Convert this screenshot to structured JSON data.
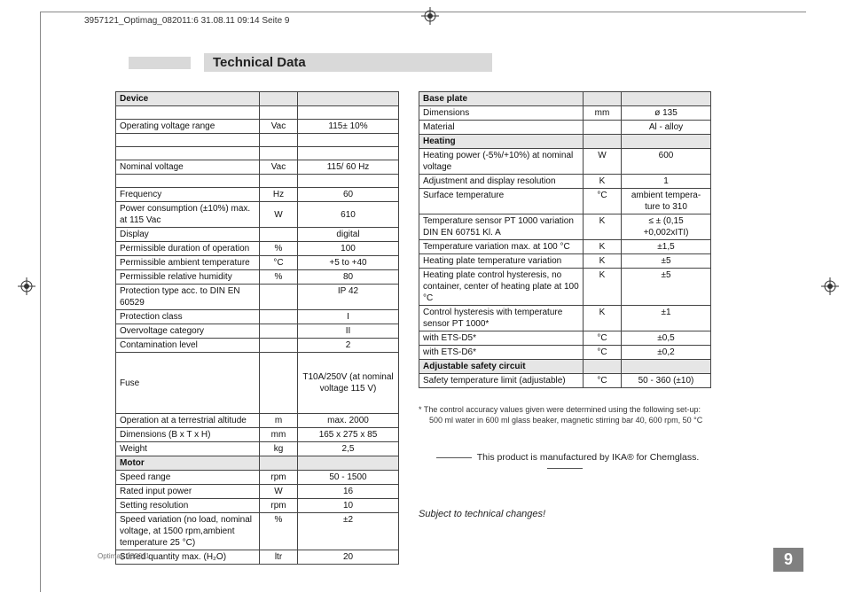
{
  "header": "3957121_Optimag_082011:6  31.08.11  09:14  Seite 9",
  "title": "Technical Data",
  "folio": "Optimag 082011",
  "page_num": "9",
  "left": {
    "s1": "Device",
    "r1l": "Operating voltage range",
    "r1u": "Vac",
    "r1v": "115± 10%",
    "r2l": "Nominal voltage",
    "r2u": "Vac",
    "r2v": "115/ 60 Hz",
    "r3l": "Frequency",
    "r3u": "Hz",
    "r3v": "60",
    "r4l": "Power consumption (±10%) max. at 115 Vac",
    "r4u": "W",
    "r4v": "610",
    "r5l": "Display",
    "r5u": "",
    "r5v": "digital",
    "r6l": "Permissible duration of operation",
    "r6u": "%",
    "r6v": "100",
    "r7l": "Permissible ambient temperature",
    "r7u": "°C",
    "r7v": "+5 to +40",
    "r8l": "Permissible relative humidity",
    "r8u": "%",
    "r8v": "80",
    "r9l": "Protection type acc. to DIN EN 60529",
    "r9u": "",
    "r9v": "IP 42",
    "r10l": "Protection class",
    "r10u": "",
    "r10v": "I",
    "r11l": "Overvoltage category",
    "r11u": "",
    "r11v": "II",
    "r12l": "Contamination level",
    "r12u": "",
    "r12v": "2",
    "r13l": "Fuse",
    "r13u": "",
    "r13v": "T10A/250V (at nominal voltage 115 V)",
    "r14l": "Operation at a terrestrial altitude",
    "r14u": "m",
    "r14v": "max. 2000",
    "r15l": "Dimensions (B x T x H)",
    "r15u": "mm",
    "r15v": "165 x 275 x 85",
    "r16l": "Weight",
    "r16u": "kg",
    "r16v": "2,5",
    "s2": "Motor",
    "r17l": "Speed range",
    "r17u": "rpm",
    "r17v": "50 - 1500",
    "r18l": "Rated input power",
    "r18u": "W",
    "r18v": "16",
    "r19l": "Setting resolution",
    "r19u": "rpm",
    "r19v": "10",
    "r20l": "Speed variation (no load, nominal voltage, at 1500 rpm,ambient temperature 25 °C)",
    "r20u": "%",
    "r20v": "±2",
    "r21l": "Stirred quantity max. (H₂O)",
    "r21u": "ltr",
    "r21v": "20"
  },
  "right": {
    "s1": "Base plate",
    "r1l": "Dimensions",
    "r1u": "mm",
    "r1v": "ø 135",
    "r2l": "Material",
    "r2u": "",
    "r2v": "Al - alloy",
    "s2": "Heating",
    "r3l": "Heating power (-5%/+10%) at nominal voltage",
    "r3u": "W",
    "r3v": "600",
    "r4l": "Adjustment and display resolution",
    "r4u": "K",
    "r4v": "1",
    "r5l": "Surface temperature",
    "r5u": "°C",
    "r5v": "ambient tempera-ture to 310",
    "r6l": "Temperature sensor PT 1000 variation DIN EN 60751 Kl. A",
    "r6u": "K",
    "r6v": "≤ ± (0,15 +0,002xITI)",
    "r7l": "Temperature variation max. at 100 °C",
    "r7u": "K",
    "r7v": "±1,5",
    "r8l": "Heating plate temperature variation",
    "r8u": "K",
    "r8v": "±5",
    "r9l": "Heating plate control hysteresis, no container, center of heating plate at 100 °C",
    "r9u": "K",
    "r9v": "±5",
    "r10l": "Control hysteresis with temperature sensor PT 1000*",
    "r10u": "K",
    "r10v": "±1",
    "r11l": "with ETS-D5*",
    "r11u": "°C",
    "r11v": "±0,5",
    "r12l": "with ETS-D6*",
    "r12u": "°C",
    "r12v": "±0,2",
    "s3": "Adjustable safety circuit",
    "r13l": "Safety temperature limit (adjustable)",
    "r13u": "°C",
    "r13v": "50 - 360 (±10)"
  },
  "footnote1": "* The control accuracy values given were determined using the following set-up:",
  "footnote2": "500 ml water in 600 ml glass beaker, magnetic stirring bar 40, 600 rpm, 50 °C",
  "mfr": "This product is manufactured by IKA® for Chemglass.",
  "changes": "Subject to technical changes!"
}
